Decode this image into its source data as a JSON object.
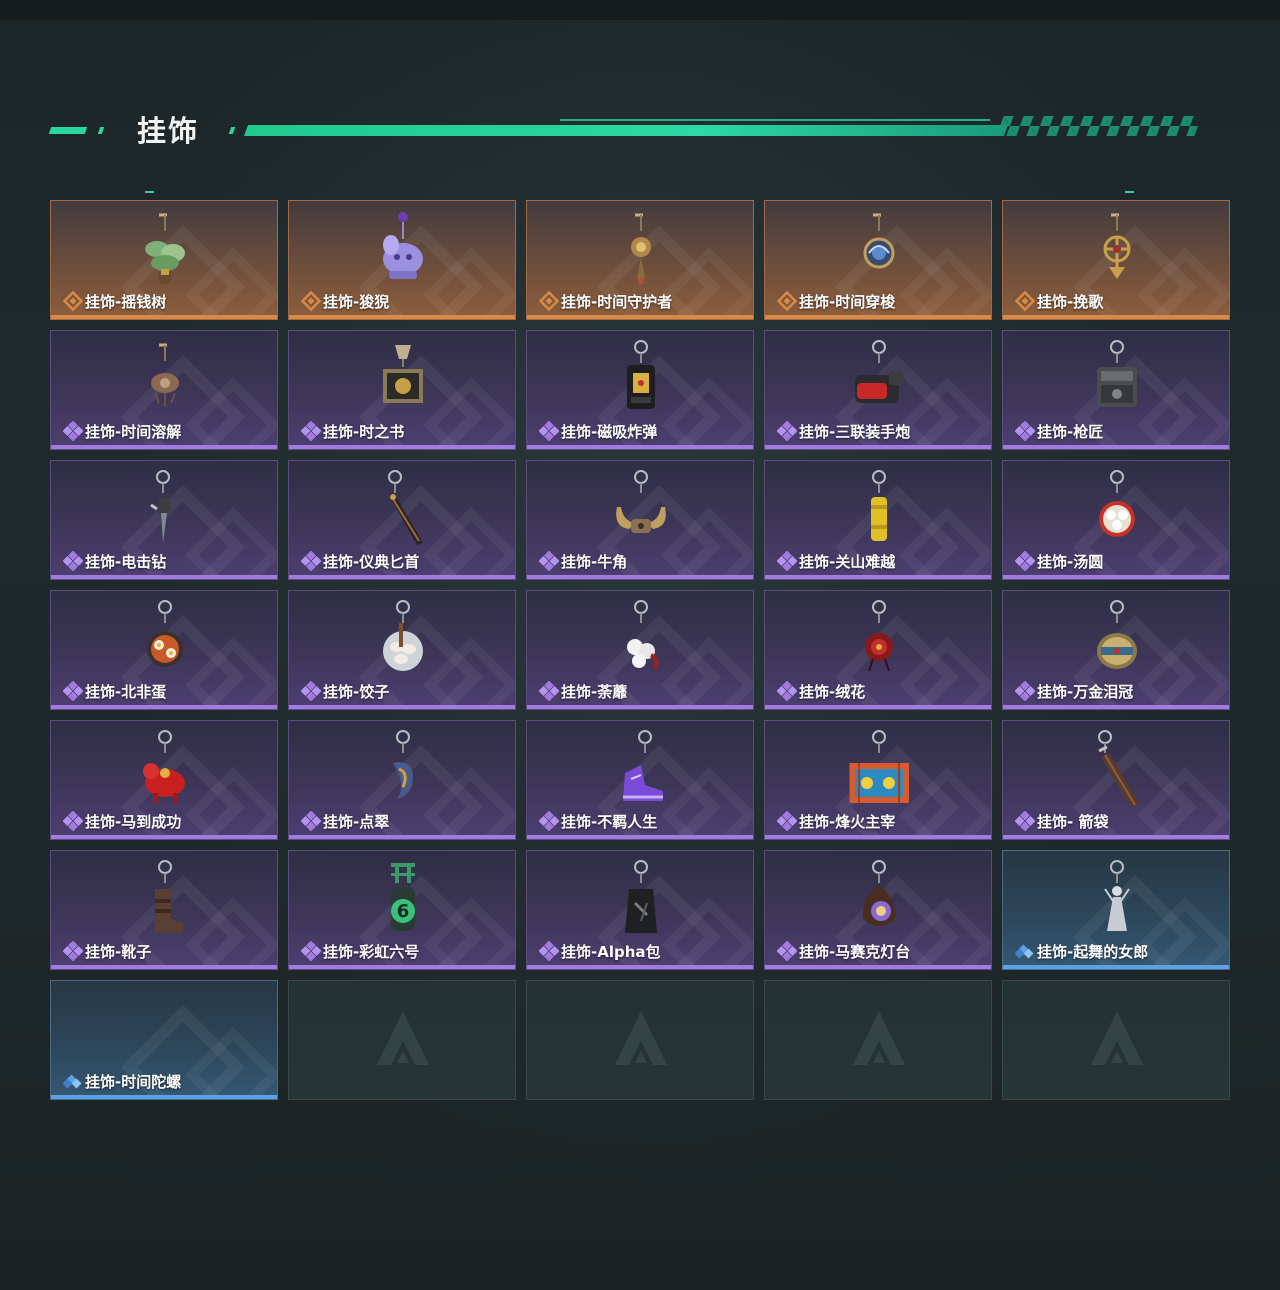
{
  "header": {
    "title": "挂饰"
  },
  "colors": {
    "accent": "#2bd7a0",
    "gold": "#d98a45",
    "purple": "#a17be0",
    "blue": "#5aa2e6"
  },
  "items": [
    {
      "label": "挂饰-摇钱树",
      "rarity": "gold",
      "icon": "money-tree-icon"
    },
    {
      "label": "挂饰-狻猊",
      "rarity": "gold",
      "icon": "purple-lion-icon"
    },
    {
      "label": "挂饰-时间守护者",
      "rarity": "gold",
      "icon": "time-guardian-icon"
    },
    {
      "label": "挂饰-时间穿梭",
      "rarity": "gold",
      "icon": "time-shuttle-icon"
    },
    {
      "label": "挂饰-挽歌",
      "rarity": "gold",
      "icon": "elegy-icon"
    },
    {
      "label": "挂饰-时间溶解",
      "rarity": "purple",
      "icon": "time-dissolve-icon"
    },
    {
      "label": "挂饰-时之书",
      "rarity": "purple",
      "icon": "book-icon"
    },
    {
      "label": "挂饰-磁吸炸弹",
      "rarity": "purple",
      "icon": "magnetic-bomb-icon"
    },
    {
      "label": "挂饰-三联装手炮",
      "rarity": "purple",
      "icon": "hand-cannon-icon"
    },
    {
      "label": "挂饰-枪匠",
      "rarity": "purple",
      "icon": "gunsmith-icon"
    },
    {
      "label": "挂饰-电击钻",
      "rarity": "purple",
      "icon": "drill-icon"
    },
    {
      "label": "挂饰-仪典匕首",
      "rarity": "purple",
      "icon": "dagger-icon"
    },
    {
      "label": "挂饰-牛角",
      "rarity": "purple",
      "icon": "horns-icon"
    },
    {
      "label": "挂饰-关山难越",
      "rarity": "purple",
      "icon": "yellow-tube-icon"
    },
    {
      "label": "挂饰-汤圆",
      "rarity": "purple",
      "icon": "tangyuan-icon"
    },
    {
      "label": "挂饰-北非蛋",
      "rarity": "purple",
      "icon": "shakshuka-icon"
    },
    {
      "label": "挂饰-饺子",
      "rarity": "purple",
      "icon": "dumplings-icon"
    },
    {
      "label": "挂饰-荼蘼",
      "rarity": "purple",
      "icon": "flower-white-icon"
    },
    {
      "label": "挂饰-绒花",
      "rarity": "purple",
      "icon": "flower-red-icon"
    },
    {
      "label": "挂饰-万金泪冠",
      "rarity": "purple",
      "icon": "crown-icon"
    },
    {
      "label": "挂饰-马到成功",
      "rarity": "purple",
      "icon": "red-horse-icon"
    },
    {
      "label": "挂饰-点翠",
      "rarity": "purple",
      "icon": "kingfisher-icon"
    },
    {
      "label": "挂饰-不羁人生",
      "rarity": "purple",
      "icon": "sneaker-icon"
    },
    {
      "label": "挂饰-烽火主宰",
      "rarity": "purple",
      "icon": "graffiti-box-icon"
    },
    {
      "label": "挂饰- 箭袋",
      "rarity": "purple",
      "icon": "quiver-icon"
    },
    {
      "label": "挂饰-靴子",
      "rarity": "purple",
      "icon": "boot-icon"
    },
    {
      "label": "挂饰-彩虹六号",
      "rarity": "purple",
      "icon": "rainbow-six-icon"
    },
    {
      "label": "挂饰-Alpha包",
      "rarity": "purple",
      "icon": "alpha-bag-icon"
    },
    {
      "label": "挂饰-马赛克灯台",
      "rarity": "purple",
      "icon": "mosaic-lamp-icon"
    },
    {
      "label": "挂饰-起舞的女郎",
      "rarity": "blue",
      "icon": "dancer-icon"
    },
    {
      "label": "挂饰-时间陀螺",
      "rarity": "blue",
      "icon": ""
    },
    {
      "label": "",
      "rarity": "empty",
      "icon": "brand-logo-icon"
    },
    {
      "label": "",
      "rarity": "empty",
      "icon": "brand-logo-icon"
    },
    {
      "label": "",
      "rarity": "empty",
      "icon": "brand-logo-icon"
    },
    {
      "label": "",
      "rarity": "empty",
      "icon": "brand-logo-icon"
    }
  ]
}
